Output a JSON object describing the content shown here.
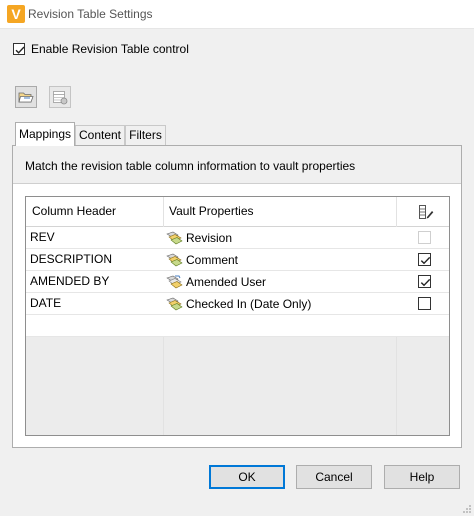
{
  "window": {
    "title": "Revision Table Settings",
    "logo_letter": "V",
    "logo_color": "#f5a623",
    "icon": "app-logo-icon"
  },
  "enable_control": {
    "label": "Enable Revision Table control",
    "checked": true
  },
  "toolbar": {
    "buttons": [
      {
        "icon": "open-folder-icon",
        "enabled": true
      },
      {
        "icon": "table-settings-icon",
        "enabled": false
      }
    ]
  },
  "tabs": [
    {
      "label": "Mappings",
      "active": true
    },
    {
      "label": "Content",
      "active": false
    },
    {
      "label": "Filters",
      "active": false
    }
  ],
  "mappings": {
    "instruction": "Match the revision table column information to vault properties",
    "columns": {
      "column_header": "Column Header",
      "vault_properties": "Vault Properties",
      "editable_icon": "column-edit-icon"
    },
    "rows": [
      {
        "column_header": "REV",
        "vault_property": "Revision",
        "editable": false,
        "checkbox_enabled": false
      },
      {
        "column_header": "DESCRIPTION",
        "vault_property": "Comment",
        "editable": true,
        "checkbox_enabled": true
      },
      {
        "column_header": "AMENDED BY",
        "vault_property": "Amended User",
        "editable": true,
        "checkbox_enabled": true
      },
      {
        "column_header": "DATE",
        "vault_property": "Checked In (Date Only)",
        "editable": false,
        "checkbox_enabled": true
      }
    ]
  },
  "buttons": {
    "ok": "OK",
    "cancel": "Cancel",
    "help": "Help"
  },
  "colors": {
    "accent": "#0078d7",
    "dialog_bg": "#f0f0f0"
  }
}
